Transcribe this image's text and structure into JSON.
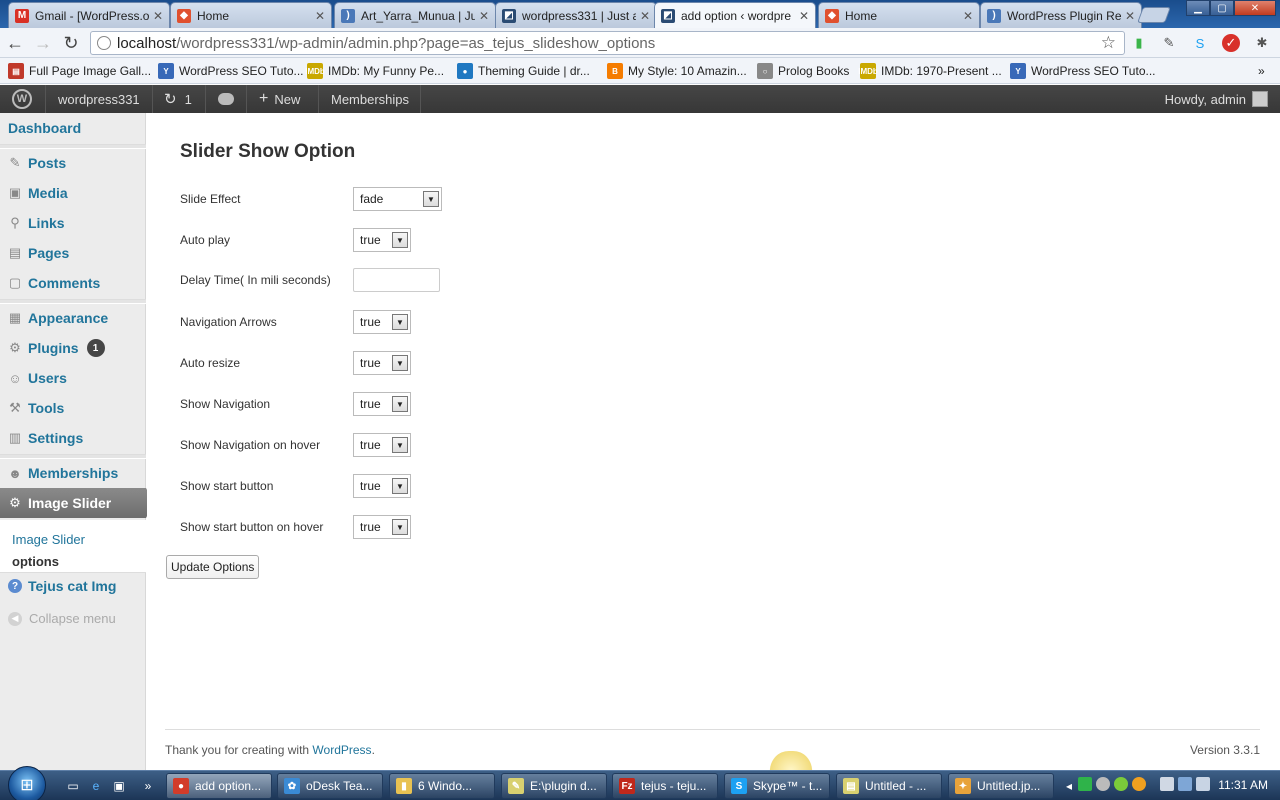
{
  "browser": {
    "tabs": [
      {
        "title": "Gmail - [WordPress.o",
        "favicon": "gmail-icon",
        "color": "#d93025",
        "glyph": "M"
      },
      {
        "title": "Home",
        "favicon": "magento-icon",
        "color": "#e0502e",
        "glyph": "◆"
      },
      {
        "title": "Art_Yarra_Munua | Ju",
        "favicon": "loading-icon",
        "color": "#4a78b8",
        "glyph": ")"
      },
      {
        "title": "wordpress331 | Just a",
        "favicon": "wp-icon",
        "color": "#2a4b73",
        "glyph": "◩"
      },
      {
        "title": "add option ‹ wordpre",
        "favicon": "wp-icon",
        "color": "#2a4b73",
        "glyph": "◩"
      },
      {
        "title": "Home",
        "favicon": "magento-icon",
        "color": "#e0502e",
        "glyph": "◆"
      },
      {
        "title": "WordPress Plugin Re",
        "favicon": "loading-icon",
        "color": "#4a78b8",
        "glyph": ")"
      }
    ],
    "active_tab": 4,
    "url_host": "localhost",
    "url_path": "/wordpress331/wp-admin/admin.php?page=as_tejus_slideshow_options",
    "bookmarks": [
      {
        "label": "Full Page Image Gall...",
        "icon": "doc-icon",
        "color": "#c0392b",
        "glyph": "▤"
      },
      {
        "label": "WordPress SEO Tuto...",
        "icon": "yoast-icon",
        "color": "#3869b8",
        "glyph": "Y"
      },
      {
        "label": "IMDb: My Funny Pe...",
        "icon": "imdb-icon",
        "color": "#c9a800",
        "glyph": "IMDb"
      },
      {
        "label": "Theming Guide | dr...",
        "icon": "drupal-icon",
        "color": "#1f78c1",
        "glyph": "●"
      },
      {
        "label": "My Style: 10 Amazin...",
        "icon": "blogger-icon",
        "color": "#f57c00",
        "glyph": "B"
      },
      {
        "label": "Prolog Books",
        "icon": "globe-icon",
        "color": "#888888",
        "glyph": "○"
      },
      {
        "label": "IMDb: 1970-Present ...",
        "icon": "imdb-icon",
        "color": "#c9a800",
        "glyph": "IMDb"
      },
      {
        "label": "WordPress SEO Tuto...",
        "icon": "yoast-icon",
        "color": "#3869b8",
        "glyph": "Y"
      }
    ],
    "overflow": "»"
  },
  "adminbar": {
    "site_name": "wordpress331",
    "updates_count": "1",
    "new_label": "New",
    "memberships": "Memberships",
    "howdy": "Howdy, admin"
  },
  "sidebar": {
    "items": [
      {
        "label": "Dashboard",
        "icon": "dashboard-icon",
        "glyph": ""
      },
      {
        "label": "Posts",
        "icon": "pin-icon",
        "glyph": "✎"
      },
      {
        "label": "Media",
        "icon": "media-icon",
        "glyph": "▣"
      },
      {
        "label": "Links",
        "icon": "link-icon",
        "glyph": "⚲"
      },
      {
        "label": "Pages",
        "icon": "pages-icon",
        "glyph": "▤"
      },
      {
        "label": "Comments",
        "icon": "comment-icon",
        "glyph": "▢"
      },
      {
        "label": "Appearance",
        "icon": "appearance-icon",
        "glyph": "▦"
      },
      {
        "label": "Plugins",
        "icon": "plugin-icon",
        "glyph": "⚙",
        "badge": "1"
      },
      {
        "label": "Users",
        "icon": "users-icon",
        "glyph": "☺"
      },
      {
        "label": "Tools",
        "icon": "tools-icon",
        "glyph": "⚒"
      },
      {
        "label": "Settings",
        "icon": "settings-icon",
        "glyph": "▥"
      },
      {
        "label": "Memberships",
        "icon": "memberships-icon",
        "glyph": "☻"
      },
      {
        "label": "Image Slider",
        "icon": "gear-icon",
        "glyph": "⚙"
      },
      {
        "label": "Tejus cat Img",
        "icon": "help-icon",
        "glyph": "?"
      }
    ],
    "submenu": [
      "Image Slider",
      "options"
    ],
    "collapse": "Collapse menu"
  },
  "page": {
    "title": "Slider Show Option",
    "options": [
      {
        "label": "Slide Effect",
        "type": "select",
        "value": "fade"
      },
      {
        "label": "Auto play",
        "type": "select",
        "value": "true"
      },
      {
        "label": "Delay Time( In mili seconds)",
        "type": "input",
        "value": ""
      },
      {
        "label": "Navigation Arrows",
        "type": "select",
        "value": "true"
      },
      {
        "label": "Auto resize",
        "type": "select",
        "value": "true"
      },
      {
        "label": "Show Navigation",
        "type": "select",
        "value": "true"
      },
      {
        "label": "Show Navigation on hover",
        "type": "select",
        "value": "true"
      },
      {
        "label": "Show start button",
        "type": "select",
        "value": "true"
      },
      {
        "label": "Show start button on hover",
        "type": "select",
        "value": "true"
      }
    ],
    "update_button": "Update Options"
  },
  "footer": {
    "thanks": "Thank you for creating with",
    "link": "WordPress",
    "period": ".",
    "version": "Version 3.3.1"
  },
  "taskbar": {
    "tasks": [
      {
        "label": "add option...",
        "icon": "chrome-icon",
        "color": "#d23c2a",
        "glyph": "●"
      },
      {
        "label": "oDesk Tea...",
        "icon": "odesk-icon",
        "color": "#3a8ad4",
        "glyph": "✿"
      },
      {
        "label": "6 Windo...",
        "icon": "folder-icon",
        "color": "#e8c252",
        "glyph": "▮"
      },
      {
        "label": "E:\\plugin d...",
        "icon": "notepad-icon",
        "color": "#d8d070",
        "glyph": "✎"
      },
      {
        "label": "tejus - teju...",
        "icon": "filezilla-icon",
        "color": "#c0281b",
        "glyph": "Fz"
      },
      {
        "label": "Skype™ - t...",
        "icon": "skype-icon",
        "color": "#1da1f2",
        "glyph": "S"
      },
      {
        "label": "Untitled - ...",
        "icon": "notepad-icon",
        "color": "#d8d070",
        "glyph": "▤"
      },
      {
        "label": "Untitled.jp...",
        "icon": "paint-icon",
        "color": "#e8a33b",
        "glyph": "✦"
      }
    ],
    "time": "11:31 AM"
  }
}
